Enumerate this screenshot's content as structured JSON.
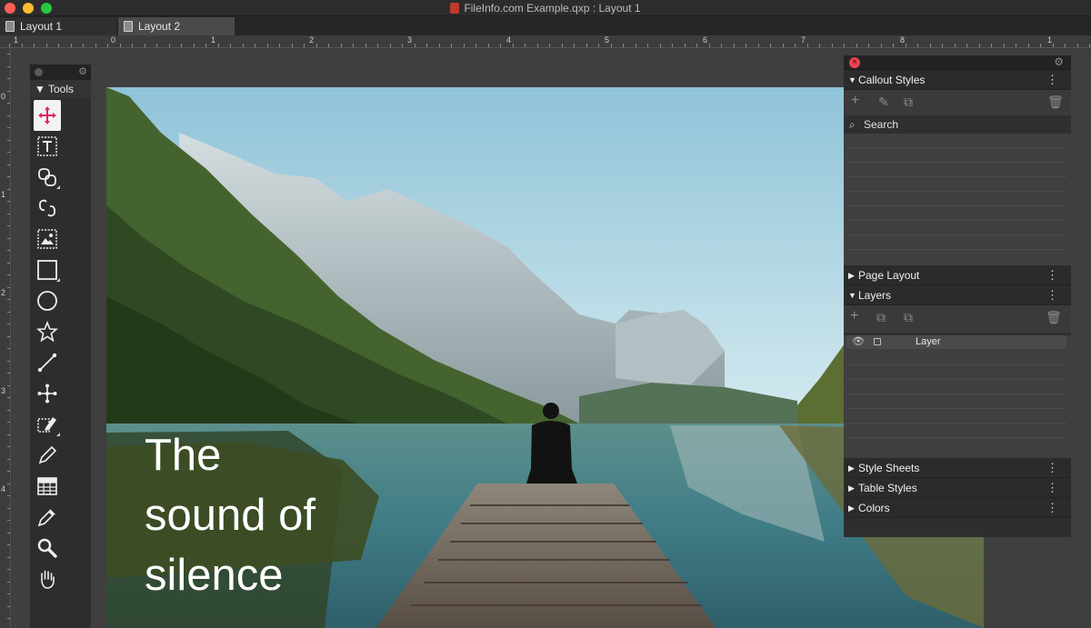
{
  "window": {
    "title": "FileInfo.com Example.qxp : Layout 1"
  },
  "tabs": [
    {
      "label": "Layout 1"
    },
    {
      "label": "Layout 2"
    }
  ],
  "ruler": {
    "horizontal_labels": [
      "1",
      "0",
      "1",
      "2",
      "3",
      "4",
      "5",
      "6",
      "7",
      "8",
      "1"
    ],
    "vertical_labels": [
      "0",
      "1",
      "2",
      "3",
      "4"
    ]
  },
  "tools_palette": {
    "title": "Tools",
    "tools": [
      {
        "name": "item-tool"
      },
      {
        "name": "text-content-tool"
      },
      {
        "name": "linking-tool"
      },
      {
        "name": "unlinking-tool"
      },
      {
        "name": "picture-content-tool"
      },
      {
        "name": "rectangle-box-tool"
      },
      {
        "name": "oval-box-tool"
      },
      {
        "name": "starburst-tool"
      },
      {
        "name": "line-tool"
      },
      {
        "name": "bezier-pen-tool"
      },
      {
        "name": "scissors-pen-tool"
      },
      {
        "name": "freehand-tool"
      },
      {
        "name": "table-tool"
      },
      {
        "name": "eyedropper-tool"
      },
      {
        "name": "zoom-tool"
      },
      {
        "name": "pan-tool"
      }
    ]
  },
  "document": {
    "headline_lines": [
      "The",
      "sound of",
      "silence"
    ]
  },
  "panels": {
    "callout_styles": {
      "title": "Callout Styles",
      "search_label": "Search"
    },
    "page_layout": {
      "title": "Page Layout"
    },
    "layers": {
      "title": "Layers",
      "rows": [
        {
          "name": "Layer"
        }
      ]
    },
    "style_sheets": {
      "title": "Style Sheets"
    },
    "table_styles": {
      "title": "Table Styles"
    },
    "colors": {
      "title": "Colors"
    }
  }
}
